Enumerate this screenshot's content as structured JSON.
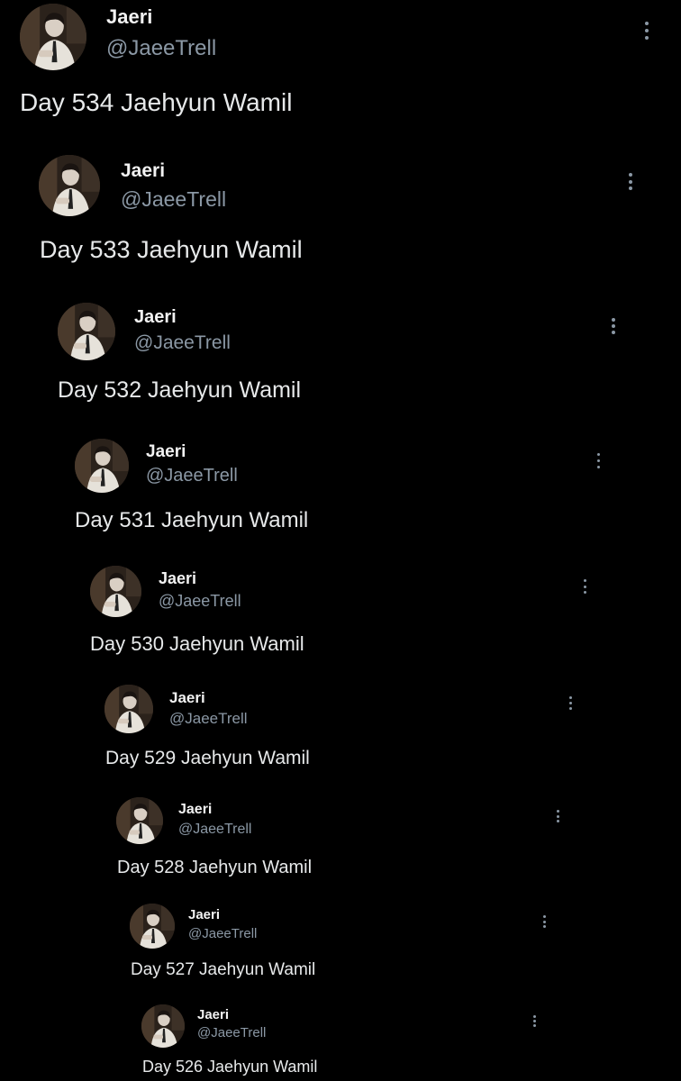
{
  "posts": [
    {
      "author": "Jaeri",
      "handle": "@JaeeTrell",
      "text": "Day 534 Jaehyun Wamil"
    },
    {
      "author": "Jaeri",
      "handle": "@JaeeTrell",
      "text": "Day 533 Jaehyun Wamil"
    },
    {
      "author": "Jaeri",
      "handle": "@JaeeTrell",
      "text": "Day 532 Jaehyun Wamil"
    },
    {
      "author": "Jaeri",
      "handle": "@JaeeTrell",
      "text": "Day 531 Jaehyun Wamil"
    },
    {
      "author": "Jaeri",
      "handle": "@JaeeTrell",
      "text": "Day 530 Jaehyun Wamil"
    },
    {
      "author": "Jaeri",
      "handle": "@JaeeTrell",
      "text": "Day 529 Jaehyun Wamil"
    },
    {
      "author": "Jaeri",
      "handle": "@JaeeTrell",
      "text": "Day 528 Jaehyun Wamil"
    },
    {
      "author": "Jaeri",
      "handle": "@JaeeTrell",
      "text": "Day 527 Jaehyun Wamil"
    },
    {
      "author": "Jaeri",
      "handle": "@JaeeTrell",
      "text": "Day 526 Jaehyun Wamil"
    }
  ],
  "icons": {
    "more": "more-options-icon",
    "avatar": "profile-avatar"
  },
  "colors": {
    "background": "#000000",
    "text": "#e7e9ea",
    "handle": "#8b98a5"
  }
}
